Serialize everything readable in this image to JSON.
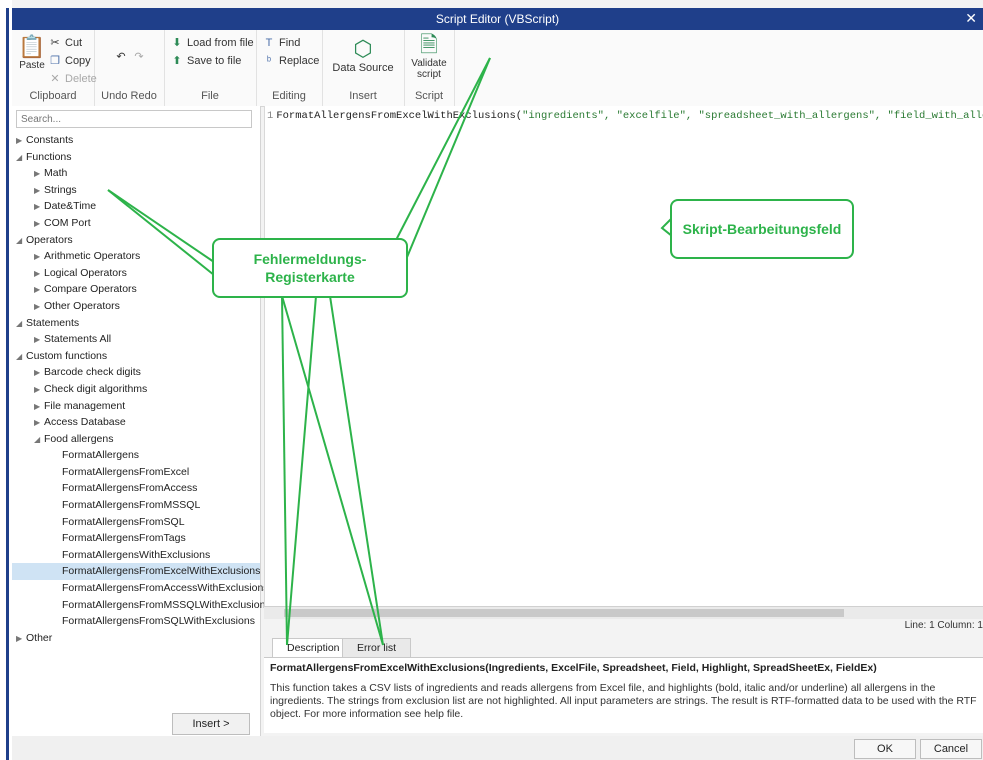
{
  "window": {
    "title": "Script Editor (VBScript)",
    "close_glyph": "✕"
  },
  "ribbon": {
    "clipboard": {
      "label": "Clipboard",
      "paste": "Paste",
      "cut": "Cut",
      "copy": "Copy",
      "delete": "Delete"
    },
    "undo_redo": {
      "label": "Undo Redo"
    },
    "file": {
      "label": "File",
      "load": "Load from file",
      "save": "Save to file"
    },
    "editing": {
      "label": "Editing",
      "find": "Find",
      "replace": "Replace"
    },
    "insert": {
      "label": "Insert",
      "data_source": "Data Source"
    },
    "script": {
      "label": "Script",
      "validate_line1": "Validate",
      "validate_line2": "script"
    }
  },
  "search": {
    "placeholder": "Search..."
  },
  "tree": [
    {
      "label": "Constants",
      "indent": 0,
      "arrow": "▶"
    },
    {
      "label": "Functions",
      "indent": 0,
      "arrow": "◢"
    },
    {
      "label": "Math",
      "indent": 1,
      "arrow": "▶"
    },
    {
      "label": "Strings",
      "indent": 1,
      "arrow": "▶"
    },
    {
      "label": "Date&Time",
      "indent": 1,
      "arrow": "▶"
    },
    {
      "label": "COM Port",
      "indent": 1,
      "arrow": "▶"
    },
    {
      "label": "Operators",
      "indent": 0,
      "arrow": "◢"
    },
    {
      "label": "Arithmetic Operators",
      "indent": 1,
      "arrow": "▶"
    },
    {
      "label": "Logical Operators",
      "indent": 1,
      "arrow": "▶"
    },
    {
      "label": "Compare Operators",
      "indent": 1,
      "arrow": "▶"
    },
    {
      "label": "Other Operators",
      "indent": 1,
      "arrow": "▶"
    },
    {
      "label": "Statements",
      "indent": 0,
      "arrow": "◢"
    },
    {
      "label": "Statements All",
      "indent": 1,
      "arrow": "▶"
    },
    {
      "label": "Custom functions",
      "indent": 0,
      "arrow": "◢"
    },
    {
      "label": "Barcode check digits",
      "indent": 1,
      "arrow": "▶"
    },
    {
      "label": "Check digit algorithms",
      "indent": 1,
      "arrow": "▶"
    },
    {
      "label": "File management",
      "indent": 1,
      "arrow": "▶"
    },
    {
      "label": "Access Database",
      "indent": 1,
      "arrow": "▶"
    },
    {
      "label": "Food allergens",
      "indent": 1,
      "arrow": "◢"
    },
    {
      "label": "FormatAllergens",
      "indent": 2,
      "arrow": ""
    },
    {
      "label": "FormatAllergensFromExcel",
      "indent": 2,
      "arrow": ""
    },
    {
      "label": "FormatAllergensFromAccess",
      "indent": 2,
      "arrow": ""
    },
    {
      "label": "FormatAllergensFromMSSQL",
      "indent": 2,
      "arrow": ""
    },
    {
      "label": "FormatAllergensFromSQL",
      "indent": 2,
      "arrow": ""
    },
    {
      "label": "FormatAllergensFromTags",
      "indent": 2,
      "arrow": ""
    },
    {
      "label": "FormatAllergensWithExclusions",
      "indent": 2,
      "arrow": ""
    },
    {
      "label": "FormatAllergensFromExcelWithExclusions",
      "indent": 2,
      "arrow": "",
      "selected": true
    },
    {
      "label": "FormatAllergensFromAccessWithExclusions",
      "indent": 2,
      "arrow": ""
    },
    {
      "label": "FormatAllergensFromMSSQLWithExclusions",
      "indent": 2,
      "arrow": ""
    },
    {
      "label": "FormatAllergensFromSQLWithExclusions",
      "indent": 2,
      "arrow": ""
    },
    {
      "label": "Other",
      "indent": 0,
      "arrow": "▶"
    }
  ],
  "insert_button": "Insert >",
  "editor": {
    "line_number": "1",
    "code_fn": "FormatAllergensFromExcelWithExclusions(",
    "code_args": "\"ingredients\", \"excelfile\", \"spreadsheet_with_allergens\", \"field_with_allergen",
    "status": "Line: 1 Column: 1"
  },
  "tabs": {
    "description": "Description",
    "error_list": "Error list"
  },
  "description": {
    "signature": "FormatAllergensFromExcelWithExclusions(Ingredients, ExcelFile, Spreadsheet, Field, Highlight, SpreadSheetEx, FieldEx)",
    "text": "This function takes a CSV lists of ingredients and reads allergens from Excel file, and highlights (bold, italic and/or underline) all allergens in the ingredients. The strings from exclusion list are not highlighted. All input parameters are strings. The result is RTF-formatted data to be used with the RTF object. For more information see help file."
  },
  "footer": {
    "ok": "OK",
    "cancel": "Cancel"
  },
  "annotations": {
    "error_tab_line1": "Fehlermeldungs-",
    "error_tab_line2": "Registerkarte",
    "editor_field": "Skript-Bearbeitungsfeld"
  },
  "colors": {
    "titlebar": "#1f3f8a",
    "callout_green": "#2db34a",
    "selection": "#cfe3f4"
  }
}
